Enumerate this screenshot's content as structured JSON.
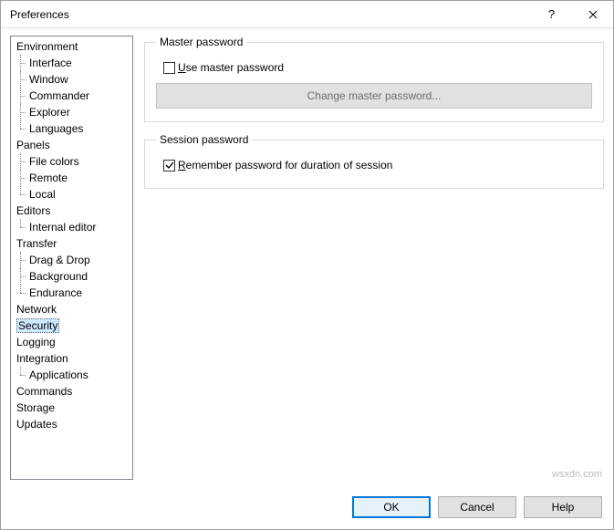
{
  "title": "Preferences",
  "tree": {
    "environment": "Environment",
    "interface": "Interface",
    "window": "Window",
    "commander": "Commander",
    "explorer": "Explorer",
    "languages": "Languages",
    "panels": "Panels",
    "filecolors": "File colors",
    "remote": "Remote",
    "local": "Local",
    "editors": "Editors",
    "internaleditor": "Internal editor",
    "transfer": "Transfer",
    "dragdrop": "Drag & Drop",
    "background": "Background",
    "endurance": "Endurance",
    "network": "Network",
    "security": "Security",
    "logging": "Logging",
    "integration": "Integration",
    "applications": "Applications",
    "commands": "Commands",
    "storage": "Storage",
    "updates": "Updates"
  },
  "groups": {
    "master_title": "Master password",
    "use_master_label": "Use master password",
    "use_master_checked": false,
    "change_master_btn": "Change master password...",
    "session_title": "Session password",
    "remember_label": "Remember password for duration of session",
    "remember_checked": true
  },
  "buttons": {
    "ok": "OK",
    "cancel": "Cancel",
    "help": "Help"
  },
  "watermark": "wsxdn.com"
}
